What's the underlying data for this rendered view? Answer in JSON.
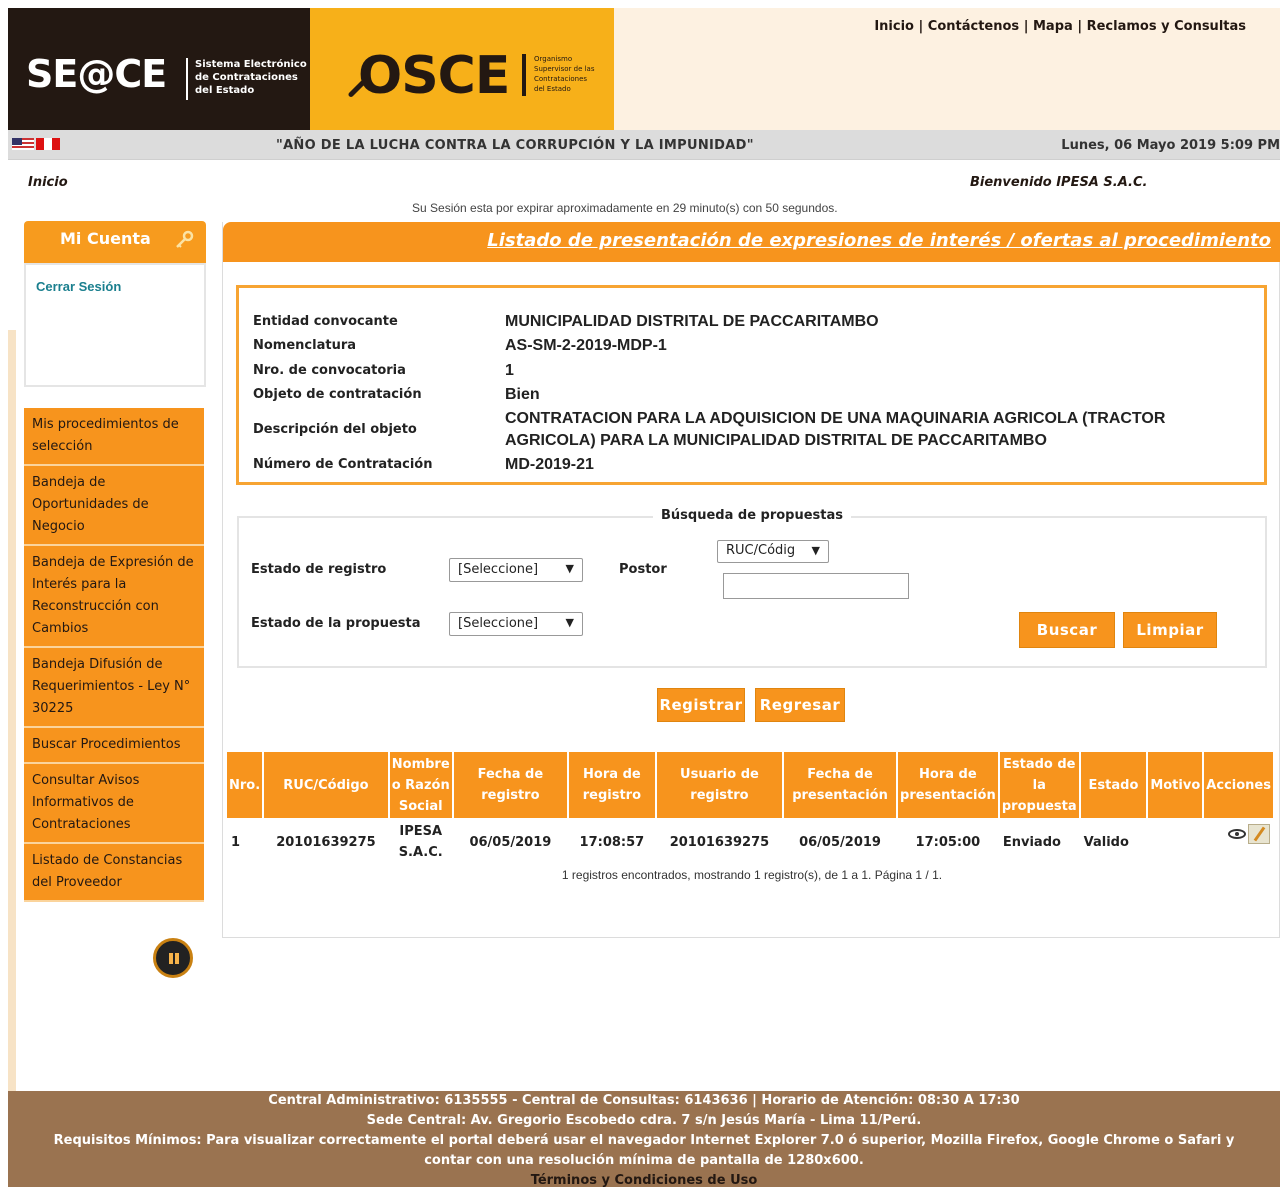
{
  "header": {
    "seace_logo": "SE@CE",
    "seace_subtitle": [
      "Sistema Electrónico",
      "de Contrataciones",
      "del Estado"
    ],
    "osce_logo": "OSCE",
    "osce_subtitle": [
      "Organismo",
      "Supervisor de las",
      "Contrataciones",
      "del Estado"
    ],
    "links": [
      "Inicio",
      "Contáctenos",
      "Mapa",
      "Reclamos y Consultas"
    ]
  },
  "slogan_bar": {
    "slogan": "\"AÑO DE LA LUCHA CONTRA LA CORRUPCIÓN Y LA IMPUNIDAD\"",
    "date": "Lunes, 06 Mayo 2019 5:09 PM"
  },
  "subheader": {
    "breadcrumb": "Inicio",
    "welcome": "Bienvenido  IPESA S.A.C.",
    "session": "Su Sesión esta por expirar aproximadamente en 29 minuto(s) con 50 segundos."
  },
  "account": {
    "title": "Mi Cuenta",
    "logout": "Cerrar Sesión"
  },
  "menu": [
    "Mis procedimientos de selección",
    "Bandeja de Oportunidades de Negocio",
    "Bandeja de Expresión de Interés para la Reconstrucción con Cambios",
    "Bandeja Difusión de Requerimientos - Ley N° 30225",
    "Buscar Procedimientos",
    "Consultar Avisos Informativos de Contrataciones",
    "Listado de Constancias del Proveedor"
  ],
  "main": {
    "title": "Listado de presentación de expresiones de interés / ofertas al procedimiento",
    "info": {
      "entidad_label": "Entidad convocante",
      "entidad": "MUNICIPALIDAD DISTRITAL DE PACCARITAMBO",
      "nomenclatura_label": "Nomenclatura",
      "nomenclatura": "AS-SM-2-2019-MDP-1",
      "convocatoria_label": "Nro. de convocatoria",
      "convocatoria": "1",
      "objeto_label": "Objeto de contratación",
      "objeto": "Bien",
      "descripcion_label": "Descripción del objeto",
      "descripcion_1": "CONTRATACION PARA LA ADQUISICION DE UNA MAQUINARIA AGRICOLA (TRACTOR",
      "descripcion_2": "AGRICOLA) PARA LA MUNICIPALIDAD DISTRITAL DE PACCARITAMBO",
      "numero_label": "Número de Contratación",
      "numero": "MD-2019-21"
    },
    "search": {
      "legend": "Búsqueda de propuestas",
      "estado_registro_label": "Estado de registro",
      "estado_registro_value": "[Seleccione]",
      "postor_label": "Postor",
      "postor_type": "RUC/Códig",
      "postor_value": "",
      "estado_propuesta_label": "Estado de la propuesta",
      "estado_propuesta_value": "[Seleccione]",
      "buscar": "Buscar",
      "limpiar": "Limpiar"
    },
    "actions": {
      "registrar": "Registrar",
      "regresar": "Regresar"
    },
    "table": {
      "headers": [
        "Nro.",
        "RUC/Código",
        "Nombre o Razón Social",
        "Fecha de registro",
        "Hora de registro",
        "Usuario de registro",
        "Fecha de presentación",
        "Hora de presentación",
        "Estado de la propuesta",
        "Estado",
        "Motivo",
        "Acciones"
      ],
      "rows": [
        [
          "1",
          "20101639275",
          "IPESA S.A.C.",
          "06/05/2019",
          "17:08:57",
          "20101639275",
          "06/05/2019",
          "17:05:00",
          "Enviado",
          "Valido",
          ""
        ]
      ]
    },
    "records": "1 registros encontrados, mostrando 1 registro(s), de 1 a 1. Página 1 / 1."
  },
  "footer": {
    "line1": "Central Administrativo: 6135555 - Central de Consultas: 6143636 | Horario de Atención: 08:30 A 17:30",
    "line2": "Sede Central: Av. Gregorio Escobedo cdra. 7 s/n Jesús María - Lima 11/Perú.",
    "line3": "Requisitos Mínimos: Para visualizar correctamente el portal deberá usar el navegador Internet Explorer 7.0 ó superior, Mozilla Firefox, Google Chrome o Safari y",
    "line4": "contar con una resolución mínima de pantalla de 1280x600.",
    "terms": "Términos y Condiciones de Uso"
  },
  "colors": {
    "orange": "#f7941d",
    "dark": "#231812",
    "footer": "#9a7350"
  }
}
